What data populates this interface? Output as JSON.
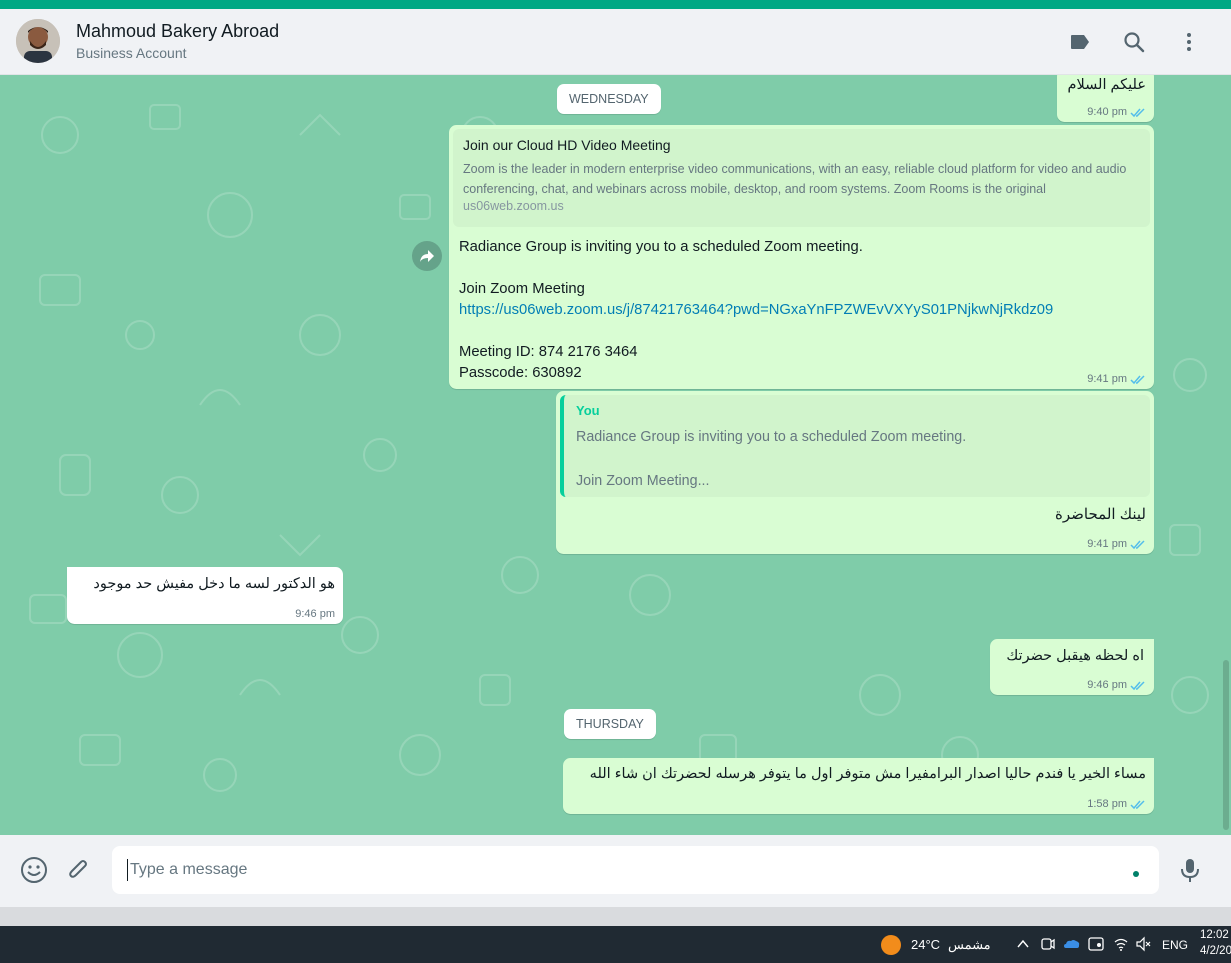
{
  "header": {
    "contact_name": "Mahmoud Bakery Abroad",
    "contact_subtitle": "Business Account"
  },
  "chat": {
    "messages": [
      {
        "text": "عليكم السلام",
        "time": "9:40 pm"
      },
      {
        "preview_title": "Join our Cloud HD Video Meeting",
        "preview_description": "Zoom is the leader in modern enterprise video communications, with an easy, reliable cloud platform for video and audio conferencing, chat, and webinars across mobile, desktop, and room systems. Zoom Rooms is the original",
        "preview_domain": "us06web.zoom.us",
        "line1": "Radiance Group is inviting you to a scheduled Zoom meeting.",
        "line2": "Join Zoom Meeting",
        "link": "https://us06web.zoom.us/j/87421763464?pwd=NGxaYnFPZWEvVXYyS01PNjkwNjRkdz09",
        "line3": "Meeting ID: 874 2176 3464",
        "line4": "Passcode: 630892",
        "time": "9:41 pm"
      },
      {
        "quote_author": "You",
        "quote_line1": "Radiance Group is inviting you to a scheduled Zoom meeting.",
        "quote_line2": "Join Zoom Meeting...",
        "text": "لينك المحاضرة",
        "time": "9:41 pm"
      },
      {
        "text": "هو الدكتور لسه ما دخل مفيش حد موجود",
        "time": "9:46 pm"
      },
      {
        "text": "اه لحظه هيقبل حضرتك",
        "time": "9:46 pm"
      },
      {
        "text": "مساء الخير يا فندم حاليا اصدار البرامفيرا مش متوفر اول ما يتوفر هرسله لحضرتك ان شاء الله",
        "time": "1:58 pm"
      }
    ],
    "date_wednesday": "WEDNESDAY",
    "date_thursday": "THURSDAY"
  },
  "footer": {
    "input_placeholder": "Type a message"
  },
  "taskbar": {
    "weather_label": "مشمس",
    "temperature": "24°C",
    "language": "ENG",
    "time": "12:02",
    "date": "4/2/20"
  },
  "colors": {
    "accent": "#00a884",
    "chat_background": "#7fcca9",
    "outgoing_bubble": "#d9fdd3",
    "incoming_bubble": "#ffffff",
    "read_ticks": "#53bdeb",
    "link": "#027eb5"
  },
  "icons": {
    "header": [
      "label-icon",
      "search-icon",
      "more-vertical-icon"
    ],
    "footer": [
      "emoji-icon",
      "attach-icon",
      "mic-icon"
    ],
    "message": [
      "double-check-icon",
      "forward-icon"
    ]
  }
}
